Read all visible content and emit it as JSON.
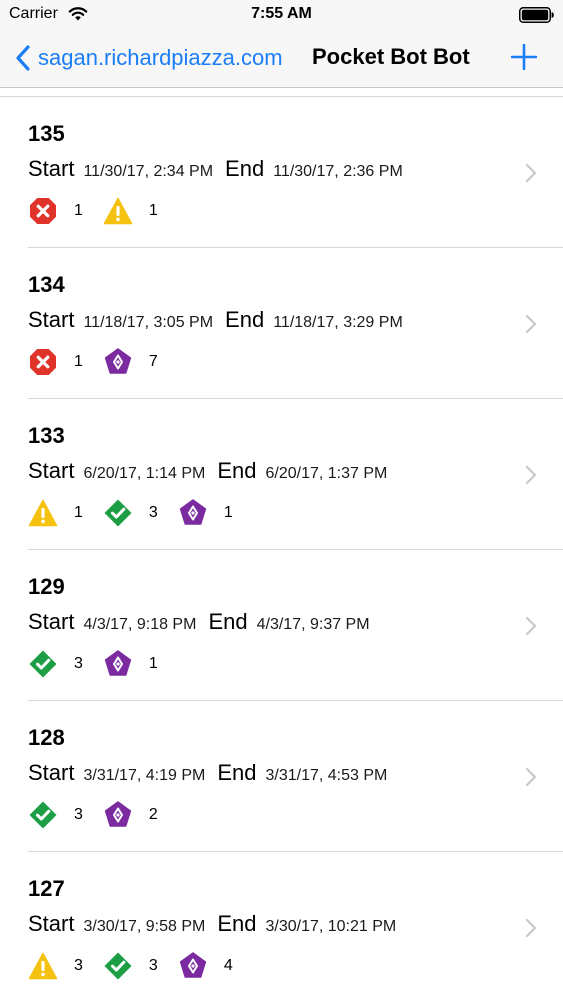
{
  "status_bar": {
    "carrier": "Carrier",
    "time": "7:55 AM"
  },
  "nav": {
    "back_label": "sagan.richardpiazza.com",
    "title": "Pocket Bot Bot"
  },
  "labels": {
    "start": "Start",
    "end": "End"
  },
  "colors": {
    "accent": "#1b7ef6",
    "error": "#e0342b",
    "warning": "#f5c211",
    "success": "#1e9e44",
    "analyzer": "#7b2aa0"
  },
  "rows": [
    {
      "id": "135",
      "start": "11/30/17, 2:34 PM",
      "end": "11/30/17, 2:36 PM",
      "badges": [
        {
          "type": "error",
          "icon": "error-icon",
          "count": "1"
        },
        {
          "type": "warning",
          "icon": "warning-icon",
          "count": "1"
        }
      ]
    },
    {
      "id": "134",
      "start": "11/18/17, 3:05 PM",
      "end": "11/18/17, 3:29 PM",
      "badges": [
        {
          "type": "error",
          "icon": "error-icon",
          "count": "1"
        },
        {
          "type": "analyzer",
          "icon": "analyzer-icon",
          "count": "7"
        }
      ]
    },
    {
      "id": "133",
      "start": "6/20/17, 1:14 PM",
      "end": "6/20/17, 1:37 PM",
      "badges": [
        {
          "type": "warning",
          "icon": "warning-icon",
          "count": "1"
        },
        {
          "type": "success",
          "icon": "success-icon",
          "count": "3"
        },
        {
          "type": "analyzer",
          "icon": "analyzer-icon",
          "count": "1"
        }
      ]
    },
    {
      "id": "129",
      "start": "4/3/17, 9:18 PM",
      "end": "4/3/17, 9:37 PM",
      "badges": [
        {
          "type": "success",
          "icon": "success-icon",
          "count": "3"
        },
        {
          "type": "analyzer",
          "icon": "analyzer-icon",
          "count": "1"
        }
      ]
    },
    {
      "id": "128",
      "start": "3/31/17, 4:19 PM",
      "end": "3/31/17, 4:53 PM",
      "badges": [
        {
          "type": "success",
          "icon": "success-icon",
          "count": "3"
        },
        {
          "type": "analyzer",
          "icon": "analyzer-icon",
          "count": "2"
        }
      ]
    },
    {
      "id": "127",
      "start": "3/30/17, 9:58 PM",
      "end": "3/30/17, 10:21 PM",
      "badges": [
        {
          "type": "warning",
          "icon": "warning-icon",
          "count": "3"
        },
        {
          "type": "success",
          "icon": "success-icon",
          "count": "3"
        },
        {
          "type": "analyzer",
          "icon": "analyzer-icon",
          "count": "4"
        }
      ]
    }
  ]
}
